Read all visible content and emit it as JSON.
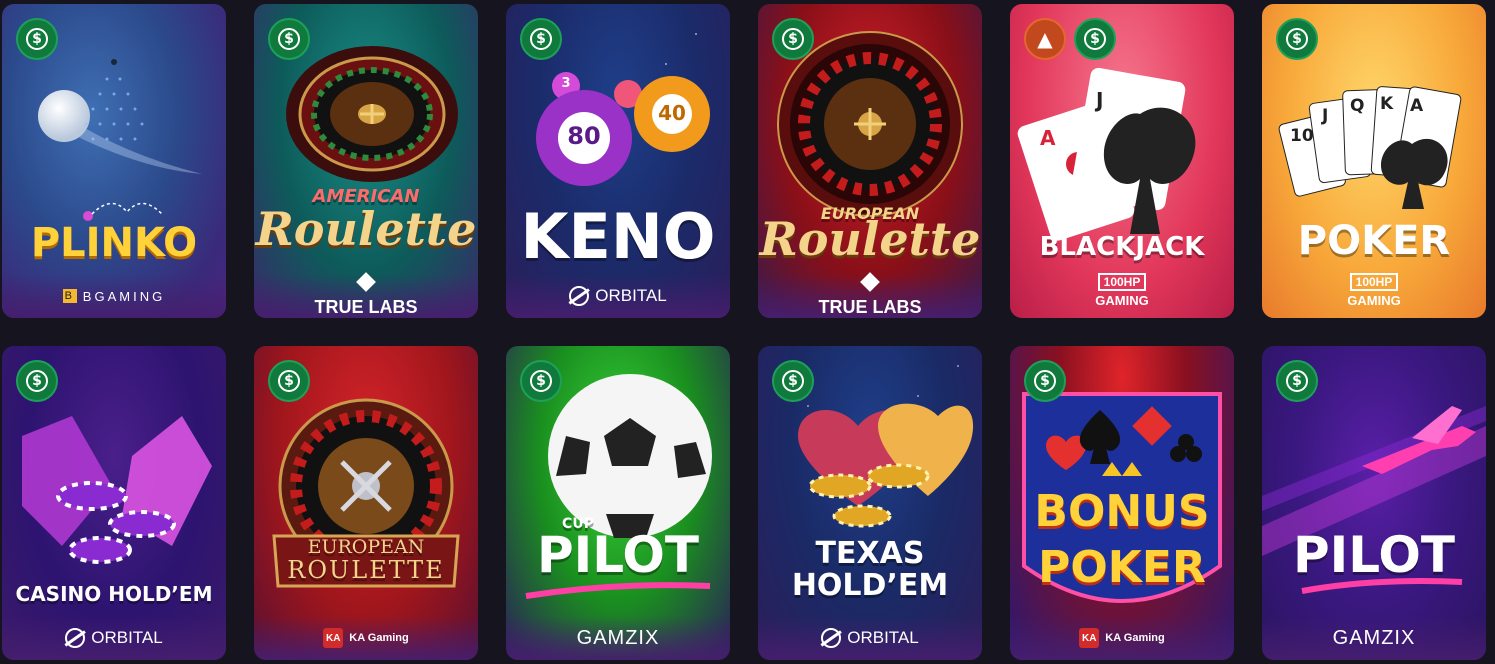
{
  "games": [
    {
      "title": "PLINKO",
      "provider": "BGAMING",
      "badges": [
        "dollar-icon"
      ]
    },
    {
      "title_top": "AMERICAN",
      "title": "Roulette",
      "provider": "TRUE LABS",
      "badges": [
        "dollar-icon"
      ]
    },
    {
      "title": "KENO",
      "provider": "ORBITAL",
      "ball_labels": [
        "80",
        "40",
        "3"
      ],
      "badges": [
        "dollar-icon"
      ]
    },
    {
      "title_top": "EUROPEAN",
      "title": "Roulette",
      "provider": "TRUE LABS",
      "badges": [
        "dollar-icon"
      ]
    },
    {
      "title": "BLACKJACK",
      "provider_top": "100HP",
      "provider": "GAMING",
      "card_labels": [
        "A",
        "J"
      ],
      "badges": [
        "fire-icon",
        "dollar-icon"
      ]
    },
    {
      "title": "POKER",
      "provider_top": "100HP",
      "provider": "GAMING",
      "card_labels": [
        "10",
        "J",
        "Q",
        "K",
        "A"
      ],
      "badges": [
        "dollar-icon"
      ]
    },
    {
      "title": "CASINO HOLD’EM",
      "provider": "ORBITAL",
      "badges": [
        "dollar-icon"
      ]
    },
    {
      "title_top": "EUROPEAN",
      "title": "ROULETTE",
      "provider": "KA Gaming",
      "provider_icon": "KA",
      "badges": [
        "dollar-icon"
      ]
    },
    {
      "title_top": "CUP",
      "title": "PILOT",
      "provider": "GAMZIX",
      "badges": [
        "dollar-icon"
      ]
    },
    {
      "title_top": "TEXAS",
      "title": "HOLD’EM",
      "provider": "ORBITAL",
      "badges": [
        "dollar-icon"
      ]
    },
    {
      "title_top": "BONUS",
      "title": "POKER",
      "provider": "KA Gaming",
      "provider_icon": "KA",
      "badges": [
        "dollar-icon"
      ]
    },
    {
      "title": "PILOT",
      "provider": "GAMZIX",
      "badges": [
        "dollar-icon"
      ]
    }
  ],
  "colors": {
    "money_badge": "#0f7a3c",
    "hot_badge": "#c2491e",
    "page_bg": "#15141f"
  }
}
